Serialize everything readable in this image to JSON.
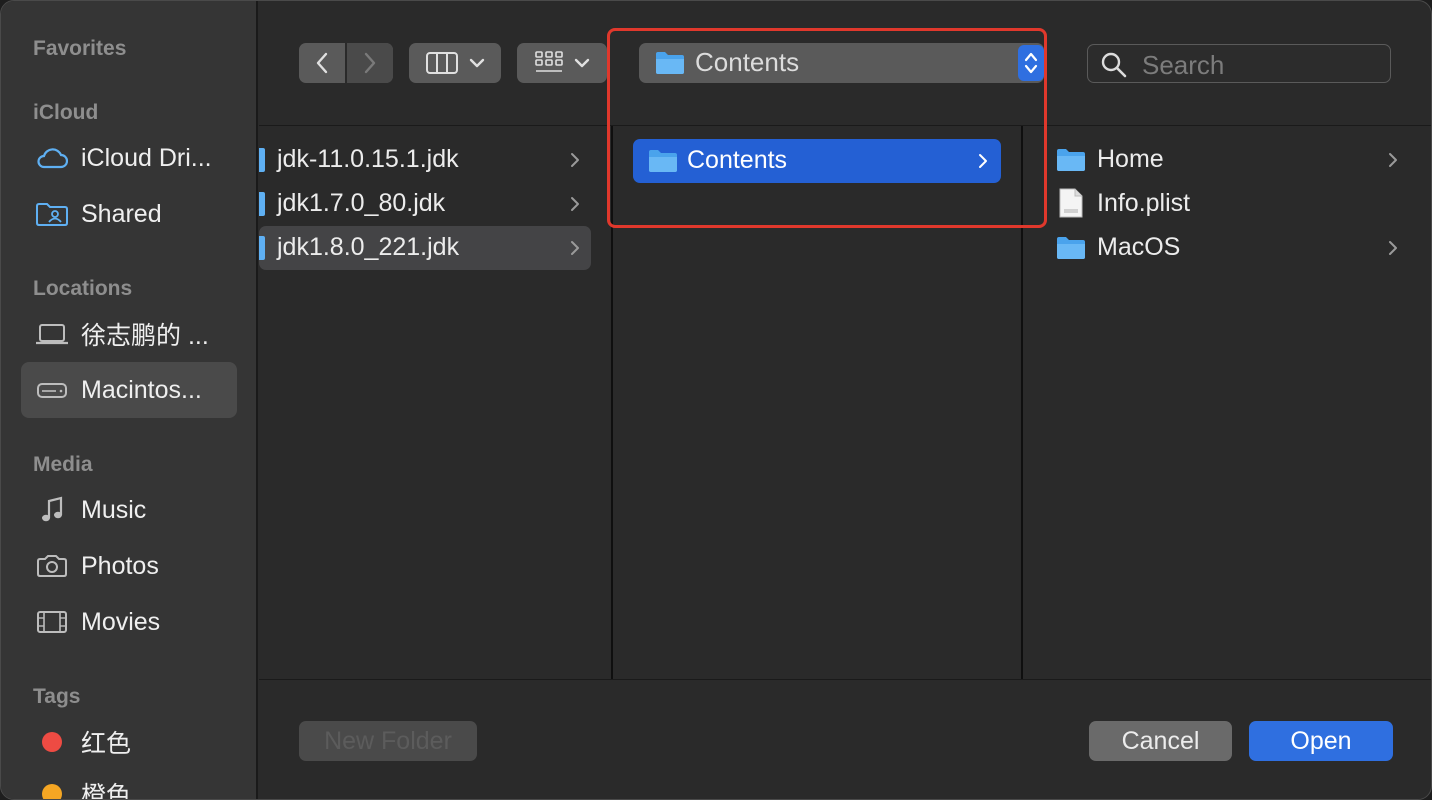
{
  "sidebar": {
    "favorites_header": "Favorites",
    "icloud_header": "iCloud",
    "icloud_items": [
      {
        "label": "iCloud Dri...",
        "icon": "cloud-icon"
      },
      {
        "label": "Shared",
        "icon": "shared-folder-icon"
      }
    ],
    "locations_header": "Locations",
    "location_items": [
      {
        "label": "徐志鹏的 ...",
        "icon": "laptop-icon"
      },
      {
        "label": "Macintos...",
        "icon": "hard-drive-icon",
        "selected": true
      }
    ],
    "media_header": "Media",
    "media_items": [
      {
        "label": "Music",
        "icon": "music-note-icon"
      },
      {
        "label": "Photos",
        "icon": "camera-icon"
      },
      {
        "label": "Movies",
        "icon": "film-icon"
      }
    ],
    "tags_header": "Tags",
    "tags": [
      {
        "label": "红色",
        "color": "#ee4b43"
      },
      {
        "label": "橙色",
        "color": "#f5a623"
      }
    ]
  },
  "toolbar": {
    "path_label": "Contents",
    "search_placeholder": "Search"
  },
  "columns": {
    "col1": [
      {
        "label": "jdk-11.0.15.1.jdk"
      },
      {
        "label": "jdk1.7.0_80.jdk"
      },
      {
        "label": "jdk1.8.0_221.jdk",
        "selected": true
      }
    ],
    "col2": [
      {
        "label": "Contents",
        "selected": true
      }
    ],
    "col3": [
      {
        "label": "Home",
        "icon": "folder-icon"
      },
      {
        "label": "Info.plist",
        "icon": "plist-file-icon"
      },
      {
        "label": "MacOS",
        "icon": "folder-icon"
      }
    ]
  },
  "buttons": {
    "new_folder": "New Folder",
    "cancel": "Cancel",
    "open": "Open"
  },
  "colors": {
    "accent": "#2460d4",
    "highlight_box": "#e0382c",
    "folder": "#5fb0f3"
  }
}
